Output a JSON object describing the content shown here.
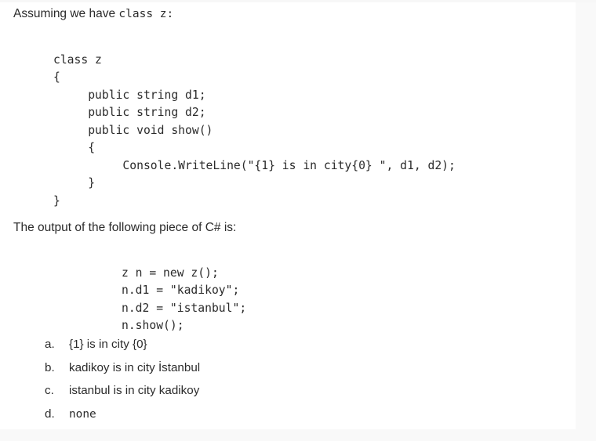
{
  "intro": {
    "prose_prefix": "Assuming we have ",
    "code_part": "class z:"
  },
  "class_code": "class z\n{\n     public string d1;\n     public string d2;\n     public void show()\n     {\n          Console.WriteLine(\"{1} is in city{0} \", d1, d2);\n     }\n}",
  "question": "The output of the following piece of C# is:",
  "usage_code": "z n = new z();\nn.d1 = \"kadikoy\";\nn.d2 = \"istanbul\";\nn.show();",
  "answers": [
    {
      "label": "a.",
      "text": "{1} is in city {0}",
      "mono": false
    },
    {
      "label": "b.",
      "text": "kadikoy is in city İstanbul",
      "mono": false
    },
    {
      "label": "c.",
      "text": "istanbul is in city kadikoy",
      "mono": false
    },
    {
      "label": "d.",
      "text": "none",
      "mono": true
    }
  ],
  "colors": {
    "page_background": "#f9f9f9",
    "sheet_background": "#ffffff",
    "text": "#2b2b2b"
  }
}
